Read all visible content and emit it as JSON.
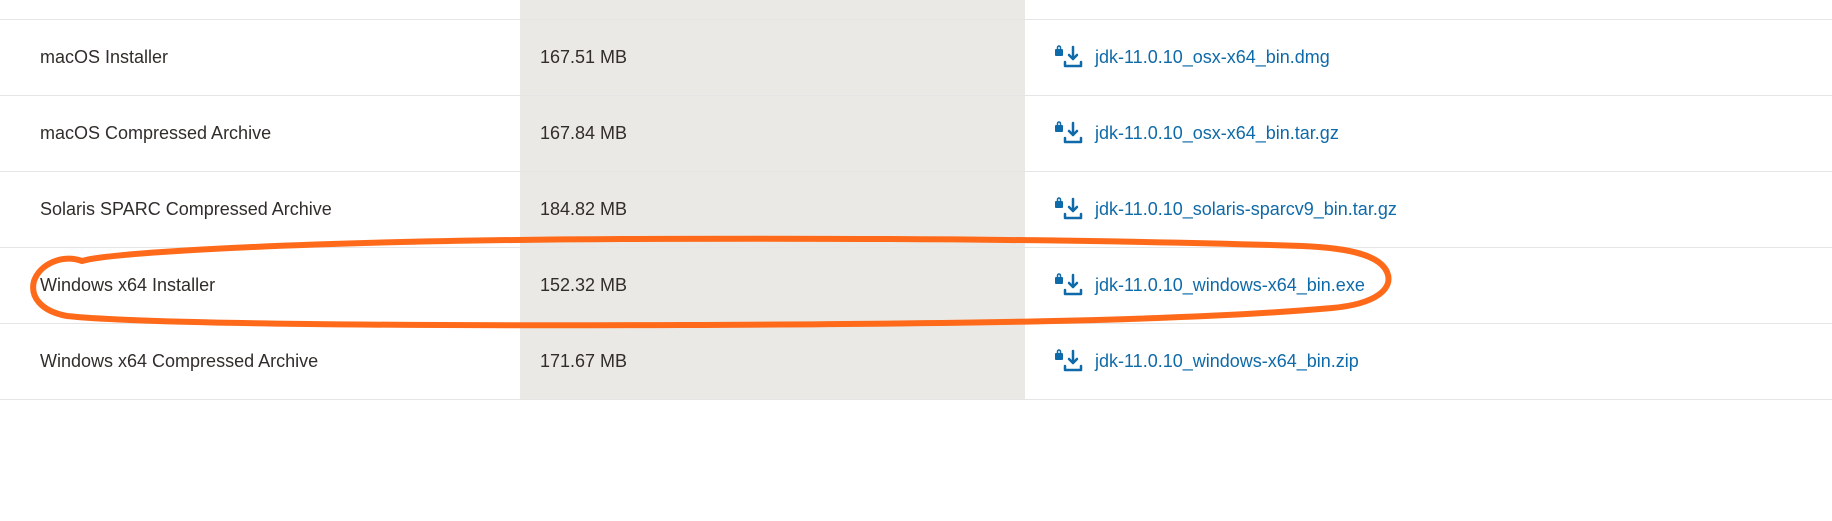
{
  "annotation": {
    "highlighted_row_index": 3,
    "color": "#ff6a1a"
  },
  "downloads": [
    {
      "description": "macOS Installer",
      "size": "167.51 MB",
      "filename": "jdk-11.0.10_osx-x64_bin.dmg"
    },
    {
      "description": "macOS Compressed Archive",
      "size": "167.84 MB",
      "filename": "jdk-11.0.10_osx-x64_bin.tar.gz"
    },
    {
      "description": "Solaris SPARC Compressed Archive",
      "size": "184.82 MB",
      "filename": "jdk-11.0.10_solaris-sparcv9_bin.tar.gz"
    },
    {
      "description": "Windows x64 Installer",
      "size": "152.32 MB",
      "filename": "jdk-11.0.10_windows-x64_bin.exe"
    },
    {
      "description": "Windows x64 Compressed Archive",
      "size": "171.67 MB",
      "filename": "jdk-11.0.10_windows-x64_bin.zip"
    }
  ]
}
